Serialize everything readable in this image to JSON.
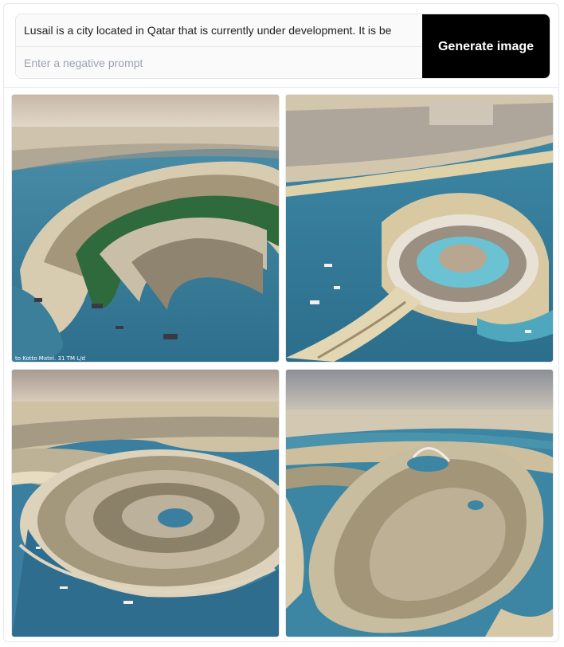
{
  "prompt": {
    "value": "Lusail is a city located in Qatar that is currently under development. It is be",
    "negative_placeholder": "Enter a negative prompt"
  },
  "generate_button_label": "Generate image",
  "gallery": {
    "images": [
      {
        "overlay_text": "to Kotto Matel. 31 TM L/d"
      },
      {
        "overlay_text": ""
      },
      {
        "overlay_text": ""
      },
      {
        "overlay_text": ""
      }
    ]
  },
  "colors": {
    "button_bg": "#000000",
    "button_text": "#ffffff",
    "water": "#3f8aa8",
    "sand": "#d9c9a3"
  }
}
